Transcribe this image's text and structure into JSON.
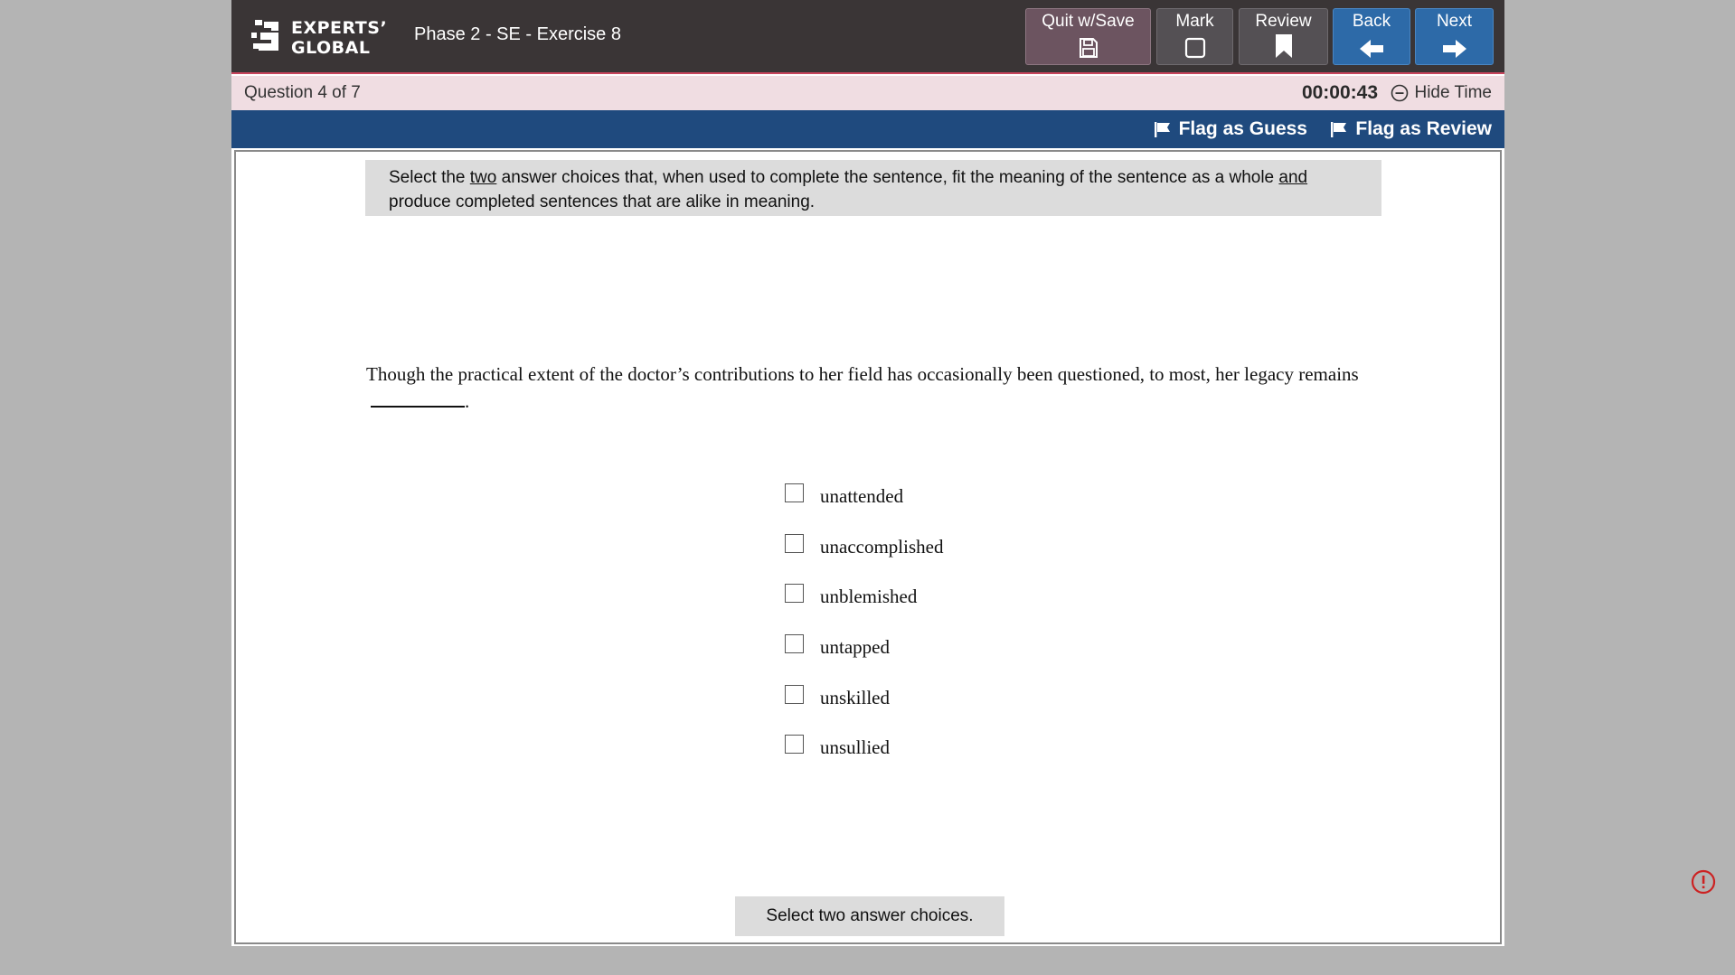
{
  "brand": {
    "line1": "EXPERTS’",
    "line2": "GLOBAL",
    "logo_color": "#ffffff"
  },
  "header": {
    "exercise_title": "Phase 2 - SE - Exercise 8"
  },
  "toolbar": {
    "quit_label": "Quit w/Save",
    "quit_icon": "save-icon",
    "mark_label": "Mark",
    "mark_icon": "checkbox-icon",
    "review_label": "Review",
    "review_icon": "bookmark-icon",
    "back_label": "Back",
    "back_icon": "arrow-left-icon",
    "next_label": "Next",
    "next_icon": "arrow-right-icon"
  },
  "status": {
    "question_counter": "Question 4 of 7",
    "timer": "00:00:43",
    "hide_time_label": "Hide Time"
  },
  "flags": {
    "guess_label": "Flag as Guess",
    "review_label": "Flag as Review"
  },
  "question": {
    "instructions_part1": "Select the ",
    "instructions_underlined1": "two",
    "instructions_part2": " answer choices that, when used to complete the sentence, fit the meaning of the sentence as a whole ",
    "instructions_underlined2": "and",
    "instructions_part3": " produce completed sentences that are alike in meaning.",
    "stem_text": "Though the practical extent of the doctor’s contributions to her field has occasionally been questioned, to most, her legacy remains",
    "stem_end": ".",
    "choices": [
      {
        "label": "unattended",
        "checked": false
      },
      {
        "label": "unaccomplished",
        "checked": false
      },
      {
        "label": "unblemished",
        "checked": false
      },
      {
        "label": "untapped",
        "checked": false
      },
      {
        "label": "unskilled",
        "checked": false
      },
      {
        "label": "unsullied",
        "checked": false
      }
    ],
    "footer_message": "Select two answer choices."
  },
  "colors": {
    "topbar": "#3a3536",
    "flagbar": "#1f4a7e",
    "statusbar": "#f0dde2",
    "nav_blue": "#2d6aa8",
    "quit_purple": "#6c5460",
    "alert_red": "#cc2222"
  }
}
